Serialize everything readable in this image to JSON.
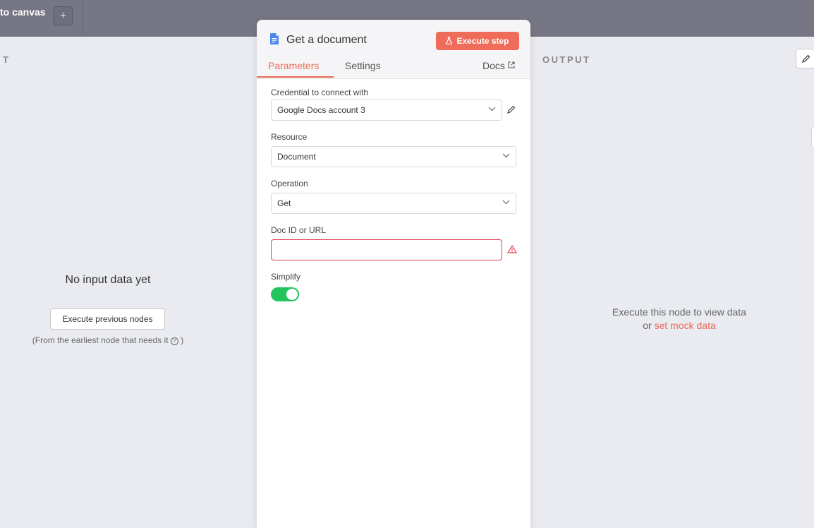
{
  "topbar": {
    "back_label": "to canvas",
    "add_label": "+"
  },
  "input_panel": {
    "label": "T",
    "empty_title": "No input data yet",
    "execute_previous_label": "Execute previous nodes",
    "hint_prefix": "(From the earliest node that needs it",
    "hint_suffix": ")"
  },
  "node": {
    "title": "Get a document",
    "execute_step_label": "Execute step",
    "tabs": {
      "parameters": "Parameters",
      "settings": "Settings",
      "docs": "Docs"
    },
    "credential": {
      "label": "Credential to connect with",
      "value": "Google Docs account 3"
    },
    "resource": {
      "label": "Resource",
      "value": "Document"
    },
    "operation": {
      "label": "Operation",
      "value": "Get"
    },
    "doc_id": {
      "label": "Doc ID or URL",
      "value": ""
    },
    "simplify": {
      "label": "Simplify",
      "enabled": true
    }
  },
  "output_panel": {
    "label": "OUTPUT",
    "message_line1": "Execute this node to view data",
    "message_or": "or",
    "mock_link": "set mock data"
  },
  "colors": {
    "accent": "#ea6a55",
    "execute_button": "#f06c5a",
    "toggle_on": "#23c45e",
    "error_border": "#e0404a",
    "topbar": "#767684",
    "doc_icon": "#4a86f0"
  },
  "icons": {
    "doc": "google-doc-icon",
    "flask": "flask-icon",
    "external": "external-link-icon",
    "chevron": "chevron-down-icon",
    "pencil": "pencil-icon",
    "warning": "warning-icon",
    "help": "help-circle-icon"
  }
}
